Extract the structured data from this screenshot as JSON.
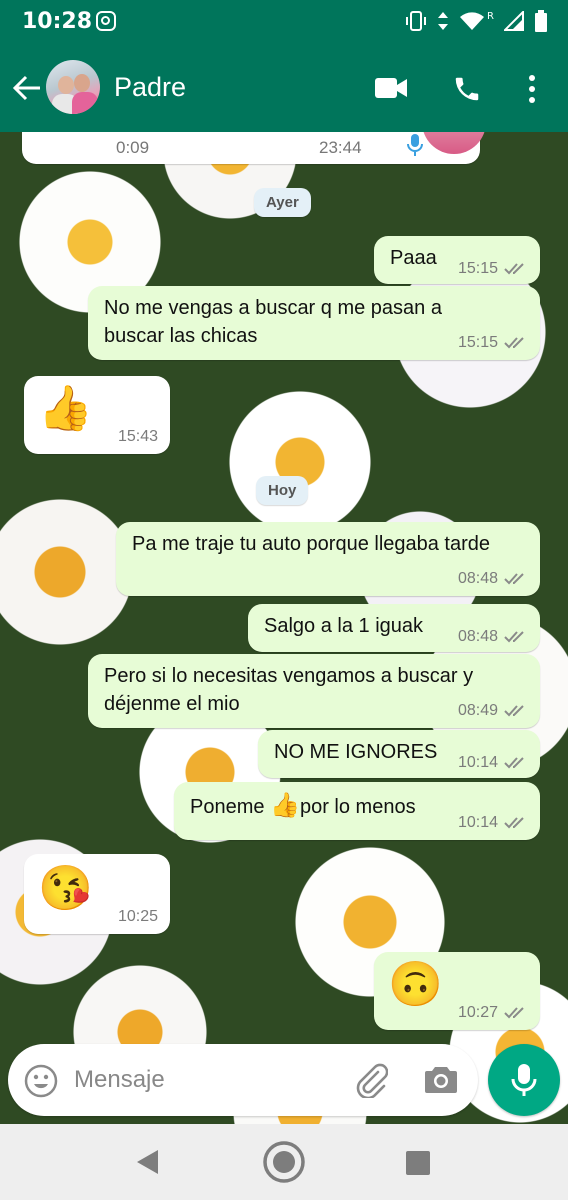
{
  "status_bar": {
    "time": "10:28",
    "roaming": "R"
  },
  "header": {
    "contact_name": "Padre",
    "back_icon": "arrow-left-icon",
    "video_icon": "videocam-icon",
    "call_icon": "phone-icon",
    "menu_icon": "more-vert-icon",
    "color": "#00755b"
  },
  "audio_message": {
    "duration": "0:09",
    "time": "23:44"
  },
  "date_chips": {
    "ayer": "Ayer",
    "hoy": "Hoy"
  },
  "messages": [
    {
      "side": "out",
      "text": "Paaa",
      "time": "15:15"
    },
    {
      "side": "out",
      "text_lines": [
        "No me vengas a buscar q me pasan a",
        "buscar las chicas"
      ],
      "time": "15:15"
    },
    {
      "side": "in",
      "emoji": "👍",
      "time": "15:43"
    },
    {
      "side": "out",
      "text": "Pa me traje tu auto porque llegaba tarde",
      "time": "08:48"
    },
    {
      "side": "out",
      "text": "Salgo a la 1 iguak",
      "time": "08:48"
    },
    {
      "side": "out",
      "text_lines": [
        "Pero si lo necesitas vengamos a buscar y",
        "déjenme el mio"
      ],
      "time": "08:49"
    },
    {
      "side": "out",
      "text": "NO ME IGNORES",
      "time": "10:14"
    },
    {
      "side": "out",
      "text_parts": [
        "Poneme ",
        "👍",
        "por lo menos"
      ],
      "time": "10:14"
    },
    {
      "side": "in",
      "emoji": "😘",
      "time": "10:25"
    },
    {
      "side": "out",
      "emoji": "🙃",
      "time": "10:27"
    }
  ],
  "composer": {
    "placeholder": "Mensaje",
    "emoji_icon": "emoji-smile-icon",
    "attach_icon": "paperclip-icon",
    "camera_icon": "camera-icon",
    "mic_icon": "microphone-icon",
    "accent": "#00a884"
  },
  "colors": {
    "outgoing_bubble": "#e7fcd6",
    "incoming_bubble": "#ffffff",
    "read_ticks": "#8a8a8a"
  }
}
